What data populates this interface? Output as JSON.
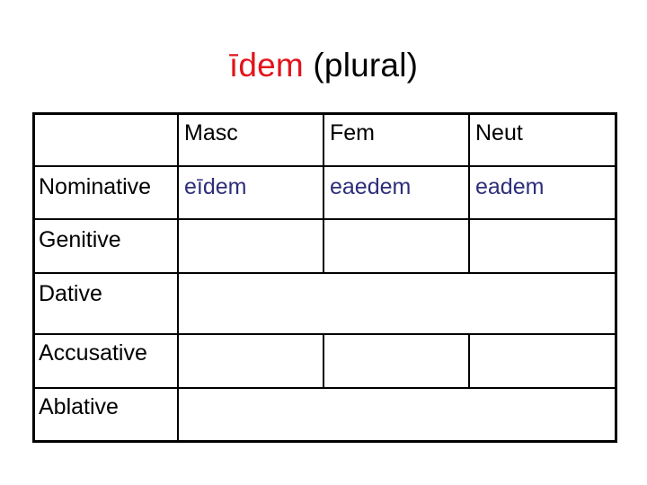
{
  "title": {
    "word": "īdem",
    "suffix": " (plural)",
    "accent_color": "#e2141c"
  },
  "table": {
    "columns": [
      "",
      "Masc",
      "Fem",
      "Neut"
    ],
    "rows": [
      {
        "case": "Nominative",
        "masc": "eīdem",
        "fem": "eaedem",
        "neut": "eadem"
      },
      {
        "case": "Genitive",
        "masc": "",
        "fem": "",
        "neut": ""
      },
      {
        "case": "Dative",
        "merged": ""
      },
      {
        "case": "Accusative",
        "masc": "",
        "fem": "",
        "neut": ""
      },
      {
        "case": "Ablative",
        "merged": ""
      }
    ],
    "value_color": "#2e2e7a"
  }
}
